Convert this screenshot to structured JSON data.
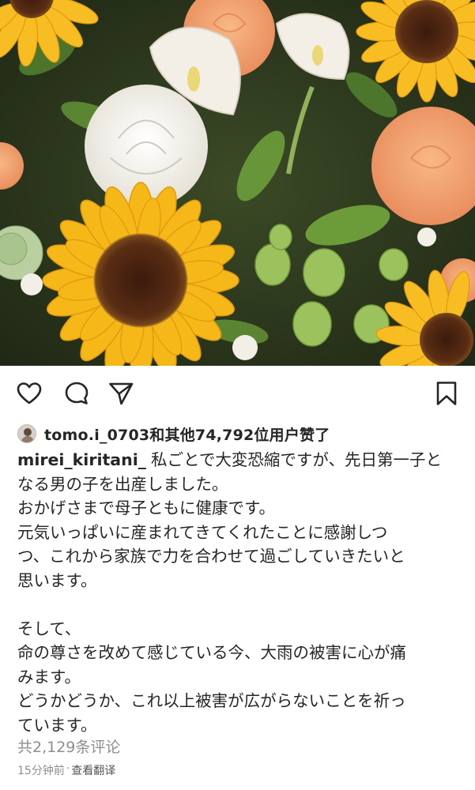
{
  "post": {
    "image_alt": "",
    "likes": {
      "liker_username": "tomo.i_0703",
      "text": "tomo.i_0703和其他74,792位用户赞了"
    },
    "caption": {
      "username": "mirei_kiritani_",
      "lines": [
        "私ごとで大変恐縮ですが、先日第一子と",
        "なる男の子を出産しました。",
        "おかげさまで母子ともに健康です。",
        "元気いっぱいに産まれてきてくれたことに感謝しつ",
        "つ、これから家族で力を合わせて過ごしていきたいと",
        "思います。",
        "",
        "そして、",
        "命の尊さを改めて感じている今、大雨の被害に心が痛",
        "みます。",
        "どうかどうか、これ以上被害が広がらないことを祈っ",
        "ています。"
      ]
    },
    "comments_link": "共2,129条评论",
    "time_ago": "15分钟前",
    "separator": "·",
    "translate_label": "查看翻译"
  },
  "icons": {
    "like": "heart-icon",
    "comment": "comment-icon",
    "share": "share-icon",
    "save": "bookmark-icon"
  },
  "colors": {
    "text": "#262626",
    "muted": "#8e8e8e",
    "sunflower_petal": "#f6b819",
    "sunflower_center": "#4a2412",
    "rose_peach": "#f4a56c",
    "calla_white": "#f3efe6",
    "leaf": "#4f7a2d"
  }
}
